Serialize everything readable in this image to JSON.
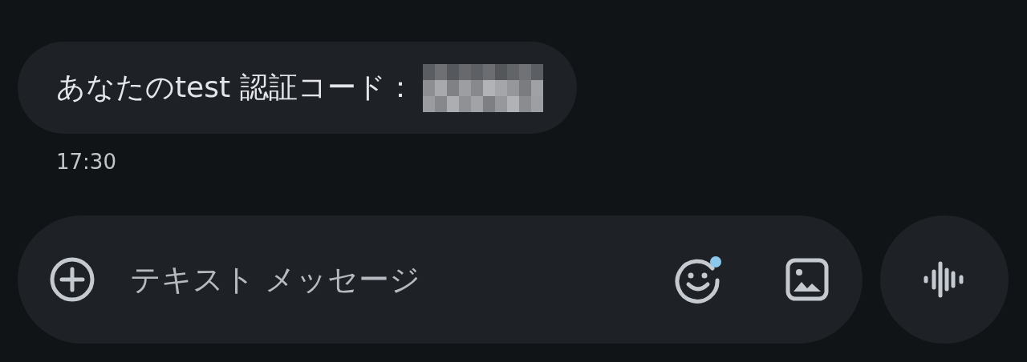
{
  "message": {
    "text": "あなたのtest 認証コード：",
    "code_redacted": true,
    "time": "17:30"
  },
  "composer": {
    "placeholder": "テキスト メッセージ",
    "emoji_badge": true
  }
}
